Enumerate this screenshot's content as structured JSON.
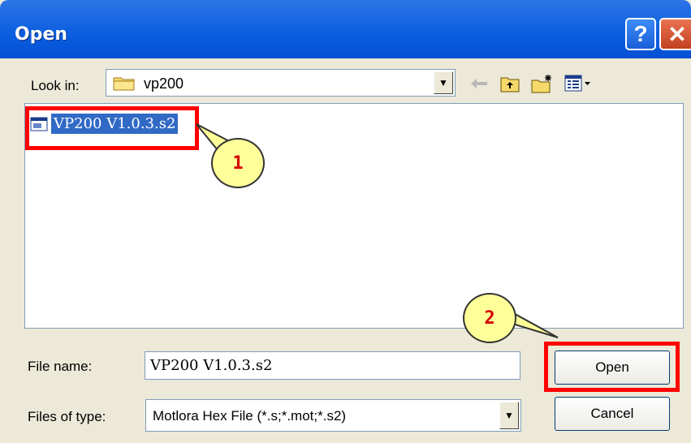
{
  "window": {
    "title": "Open",
    "help_label": "?",
    "close_label": "✕"
  },
  "look_in": {
    "label": "Look in:",
    "value": "vp200"
  },
  "toolbar": {
    "icons": [
      "back-arrow-icon",
      "up-folder-icon",
      "new-folder-icon",
      "view-menu-icon"
    ]
  },
  "files": [
    {
      "name": "VP200 V1.0.3.s2",
      "selected": true
    }
  ],
  "callouts": {
    "first": "1",
    "second": "2"
  },
  "file_name": {
    "label": "File name:",
    "value": "VP200 V1.0.3.s2"
  },
  "file_type": {
    "label": "Files of type:",
    "value": "Motlora Hex File (*.s;*.mot;*.s2)"
  },
  "buttons": {
    "open": "Open",
    "cancel": "Cancel"
  },
  "colors": {
    "titlebar": "#0450d4",
    "highlight": "#ff0000",
    "selection": "#316ac5",
    "callout_fill": "#ffff99",
    "callout_text": "#d40000"
  }
}
